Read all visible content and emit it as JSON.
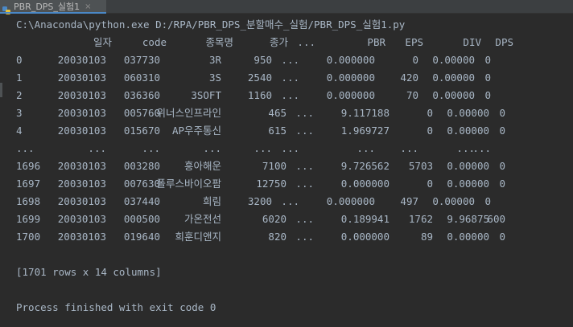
{
  "tab": {
    "label": "PBR_DPS_실험1",
    "close": "×",
    "icon": "python-file-icon"
  },
  "console": {
    "command": "C:\\Anaconda\\python.exe D:/RPA/PBR_DPS_분할매수_실험/PBR_DPS_실험1.py",
    "headers": [
      "일자",
      "code",
      "종목명",
      "종가",
      "...",
      "PBR",
      "EPS",
      "DIV",
      "DPS"
    ],
    "rows": [
      [
        "0",
        "20030103",
        "037730",
        "3R",
        "950",
        "...",
        "0.000000",
        "0",
        "0.00000",
        "0"
      ],
      [
        "1",
        "20030103",
        "060310",
        "3S",
        "2540",
        "...",
        "0.000000",
        "420",
        "0.00000",
        "0"
      ],
      [
        "2",
        "20030103",
        "036360",
        "3SOFT",
        "1160",
        "...",
        "0.000000",
        "70",
        "0.00000",
        "0"
      ],
      [
        "3",
        "20030103",
        "005760",
        "위너스인프라인",
        "465",
        "...",
        "9.117188",
        "0",
        "0.00000",
        "0"
      ],
      [
        "4",
        "20030103",
        "015670",
        "AP우주통신",
        "615",
        "...",
        "1.969727",
        "0",
        "0.00000",
        "0"
      ],
      [
        "...",
        "...",
        "...",
        "...",
        "...",
        "...",
        "...",
        "...",
        "...",
        "..."
      ],
      [
        "1696",
        "20030103",
        "003280",
        "흥아해운",
        "7100",
        "...",
        "9.726562",
        "5703",
        "0.00000",
        "0"
      ],
      [
        "1697",
        "20030103",
        "007630",
        "폴루스바이오팜",
        "12750",
        "...",
        "0.000000",
        "0",
        "0.00000",
        "0"
      ],
      [
        "1698",
        "20030103",
        "037440",
        "희림",
        "3200",
        "...",
        "0.000000",
        "497",
        "0.00000",
        "0"
      ],
      [
        "1699",
        "20030103",
        "000500",
        "가온전선",
        "6020",
        "...",
        "0.189941",
        "1762",
        "9.96875",
        "600"
      ],
      [
        "1700",
        "20030103",
        "019640",
        "희훈디앤지",
        "820",
        "...",
        "0.000000",
        "89",
        "0.00000",
        "0"
      ]
    ],
    "summary": "[1701 rows x 14 columns]",
    "exit_message": "Process finished with exit code 0"
  }
}
